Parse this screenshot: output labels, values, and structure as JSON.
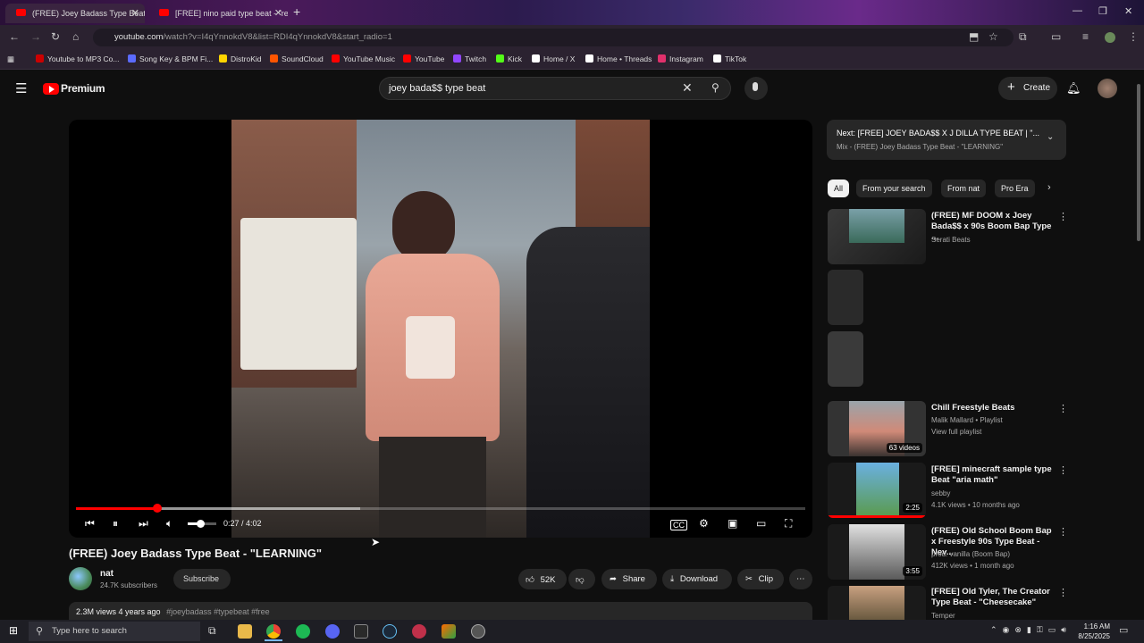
{
  "browser": {
    "tabs": [
      {
        "label": "(FREE) Joey Badass Type Beat"
      },
      {
        "label": "[FREE] nino paid type beat - \"re"
      }
    ],
    "url": "youtube.com",
    "url_rest": "/watch?v=I4qYnnokdV8&list=RDI4qYnnokdV8&start_radio=1",
    "bookmarks": [
      {
        "label": "Youtube to MP3 Co...",
        "color": "#cc0000"
      },
      {
        "label": "Song Key & BPM Fi...",
        "color": "#5b6bff"
      },
      {
        "label": "DistroKid",
        "color": "#ffd400"
      },
      {
        "label": "SoundCloud",
        "color": "#ff5500"
      },
      {
        "label": "YouTube Music",
        "color": "#ff0000"
      },
      {
        "label": "YouTube",
        "color": "#ff0000"
      },
      {
        "label": "Twitch",
        "color": "#9146ff"
      },
      {
        "label": "Kick",
        "color": "#53fc18"
      },
      {
        "label": "Home / X",
        "color": "#ffffff"
      },
      {
        "label": "Home • Threads",
        "color": "#ffffff"
      },
      {
        "label": "Instagram",
        "color": "#e1306c"
      },
      {
        "label": "TikTok",
        "color": "#ffffff"
      }
    ]
  },
  "youtube": {
    "logo_text": "Premium",
    "search_value": "joey bada$$ type beat",
    "create_label": "Create"
  },
  "player": {
    "time": "0:27 / 4:02",
    "played_fraction": 0.1116,
    "buffered_fraction": 0.39,
    "volume_fraction": 0.45
  },
  "video": {
    "title": "(FREE) Joey Badass Type Beat - \"LEARNING\"",
    "channel": "nat",
    "subscribers": "24.7K subscribers",
    "subscribe_label": "Subscribe",
    "likes": "52K",
    "share_label": "Share",
    "download_label": "Download",
    "clip_label": "Clip",
    "views_line": "2.3M views  4 years ago",
    "tags_line": "#joeybadass #typebeat #free"
  },
  "sidebar": {
    "next_title": "Next: [FREE] JOEY BADA$$ X J DILLA TYPE BEAT | \"...",
    "next_sub": "Mix - (FREE) Joey Badass Type Beat - \"LEARNING\"",
    "chips": [
      "All",
      "From your search",
      "From nat",
      "Pro Era"
    ],
    "items": [
      {
        "title": "(FREE) MF DOOM x Joey Bada$$ x 90s Boom Bap Type ...",
        "meta1": "Serati Beats",
        "meta2": "",
        "meta3": "",
        "duration": ""
      },
      {
        "title": "Chill Freestyle Beats",
        "meta1": "Malik Mallard • Playlist",
        "meta2": "View full playlist",
        "meta3": "",
        "duration": "63 videos"
      },
      {
        "title": "[FREE] minecraft sample type Beat \"aria math\"",
        "meta1": "sebby",
        "meta2": "4.1K views • 10 months ago",
        "meta3": "",
        "duration": "2:25"
      },
      {
        "title": "(FREE) Old School Boom Bap x Freestyle 90s Type Beat - Nev...",
        "meta1": "prod. vanilla (Boom Bap)",
        "meta2": "412K views • 1 month ago",
        "meta3": "",
        "duration": "3:55"
      },
      {
        "title": "[FREE] Old Tyler, The Creator Type Beat - \"Cheesecake\"",
        "meta1": "Temper",
        "meta2": "",
        "meta3": "",
        "duration": ""
      }
    ]
  },
  "taskbar": {
    "search_placeholder": "Type here to search",
    "time": "1:16 AM",
    "date": "8/25/2025"
  }
}
